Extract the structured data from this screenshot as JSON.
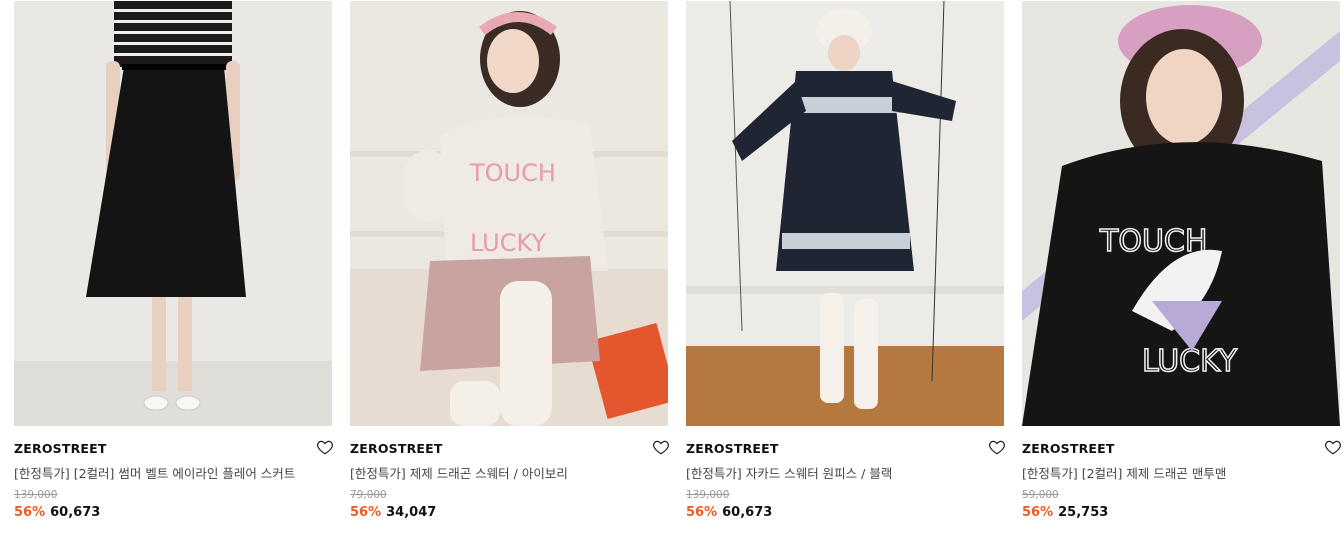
{
  "colors": {
    "discount": "#f15a24",
    "brand_text": "#111111",
    "original_price": "#999999"
  },
  "products": [
    {
      "brand": "ZEROSTREET",
      "name": "[한정특가] [2컬러] 썸머 벨트 에이라인 플레어 스커트",
      "original_price": "139,000",
      "discount": "56%",
      "price": "60,673",
      "wishlist_icon": "heart-outline-icon",
      "image_desc": "model in black striped top and black flare skirt"
    },
    {
      "brand": "ZEROSTREET",
      "name": "[한정특가] 제제 드래곤 스웨터 / 아이보리",
      "original_price": "79,000",
      "discount": "56%",
      "price": "34,047",
      "wishlist_icon": "heart-outline-icon",
      "image_desc": "model in ivory dragon sweater sitting on rug"
    },
    {
      "brand": "ZEROSTREET",
      "name": "[한정특가] 자카드 스웨터 원피스 / 블랙",
      "original_price": "139,000",
      "discount": "56%",
      "price": "60,673",
      "wishlist_icon": "heart-outline-icon",
      "image_desc": "model in black jacquard sweater dress and white boots"
    },
    {
      "brand": "ZEROSTREET",
      "name": "[한정특가] [2컬러] 제제 드래곤 맨투맨",
      "original_price": "59,000",
      "discount": "56%",
      "price": "25,753",
      "wishlist_icon": "heart-outline-icon",
      "image_desc": "model in black dragon sweatshirt and pink beret"
    }
  ]
}
